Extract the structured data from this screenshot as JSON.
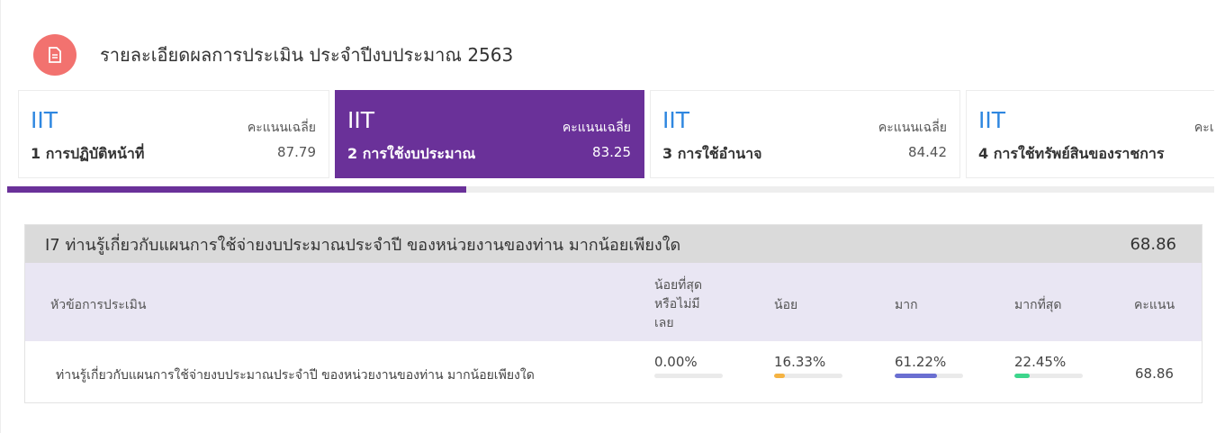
{
  "header": {
    "title": "รายละเอียดผลการประเมิน ประจำปีงบประมาณ 2563",
    "icon": "document-icon",
    "icon_color": "#f2726f"
  },
  "cards": [
    {
      "prefix": "IIT",
      "avg_label": "คะแนนเฉลี่ย",
      "name": "1 การปฏิบัติหน้าที่",
      "score": "87.79",
      "active": false
    },
    {
      "prefix": "IIT",
      "avg_label": "คะแนนเฉลี่ย",
      "name": "2 การใช้งบประมาณ",
      "score": "83.25",
      "active": true
    },
    {
      "prefix": "IIT",
      "avg_label": "คะแนนเฉลี่ย",
      "name": "3 การใช้อำนาจ",
      "score": "84.42",
      "active": false
    },
    {
      "prefix": "IIT",
      "avg_label": "คะแนนเฉลี่ย",
      "name": "4 การใช้ทรัพย์สินของราชการ",
      "score": "",
      "active": false
    }
  ],
  "colors": {
    "accent": "#6a3199",
    "iit_blue": "#2f87e0"
  },
  "carousel_progress": 0.38,
  "question": {
    "title": "I7 ท่านรู้เกี่ยวกับแผนการใช้จ่ายงบประมาณประจำปี ของหน่วยงานของท่าน มากน้อยเพียงใด",
    "score": "68.86",
    "columns": {
      "topic": "หัวข้อการประเมิน",
      "least_line1": "น้อยที่สุด",
      "least_line2": "หรือไม่มี",
      "least_line3": "เลย",
      "little": "น้อย",
      "much": "มาก",
      "most": "มากที่สุด",
      "score": "คะแนน"
    },
    "rows": [
      {
        "text": "ท่านรู้เกี่ยวกับแผนการใช้จ่ายงบประมาณประจำปี ของหน่วยงานของท่าน มากน้อยเพียงใด",
        "least": {
          "label": "0.00%",
          "value": 0.0,
          "color": "#cccccc"
        },
        "little": {
          "label": "16.33%",
          "value": 16.33,
          "color": "#f5b342"
        },
        "much": {
          "label": "61.22%",
          "value": 61.22,
          "color": "#6a6fd1"
        },
        "most": {
          "label": "22.45%",
          "value": 22.45,
          "color": "#3dd68c"
        },
        "score": "68.86"
      }
    ]
  }
}
